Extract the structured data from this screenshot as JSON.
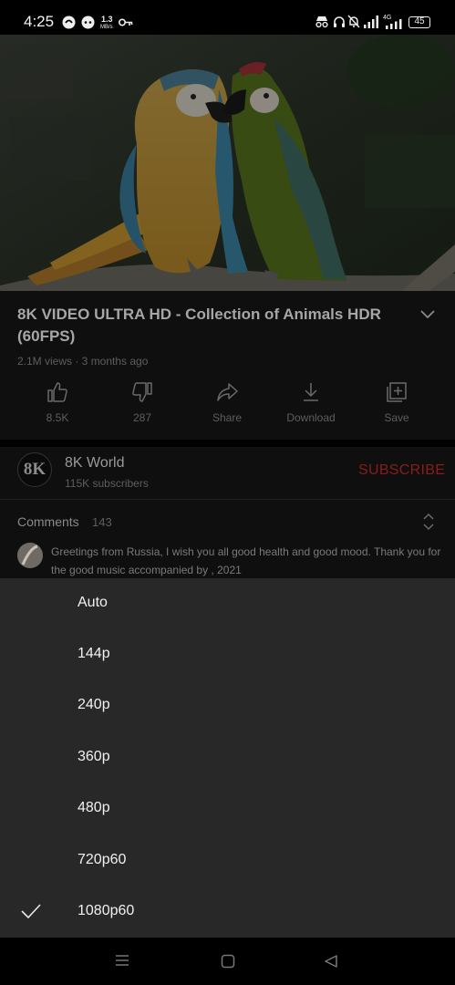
{
  "status_bar": {
    "time": "4:25",
    "speed_value": "1.3",
    "speed_unit": "MB/s",
    "network": "4G",
    "battery": "45"
  },
  "video": {
    "subject": "two macaws perched on a branch"
  },
  "info": {
    "title": "8K VIDEO ULTRA HD - Collection of Animals HDR (60FPS)",
    "meta": "2.1M views · 3 months ago"
  },
  "actions": [
    {
      "label": "8.5K",
      "icon": "thumbs-up-icon"
    },
    {
      "label": "287",
      "icon": "thumbs-down-icon"
    },
    {
      "label": "Share",
      "icon": "share-icon"
    },
    {
      "label": "Download",
      "icon": "download-icon"
    },
    {
      "label": "Save",
      "icon": "save-to-playlist-icon"
    }
  ],
  "channel": {
    "avatar_text": "8K",
    "name": "8K World",
    "subscribers": "115K subscribers",
    "subscribe_label": "SUBSCRIBE",
    "subscribe_color": "#8a1c1c"
  },
  "comments": {
    "title": "Comments",
    "count": "143",
    "top_comment": "Greetings from Russia, I wish you all good health and good mood. Thank you for the good music accompanied by , 2021"
  },
  "quality_sheet": {
    "options": [
      "Auto",
      "144p",
      "240p",
      "360p",
      "480p",
      "720p60",
      "1080p60"
    ],
    "selected": "1080p60"
  },
  "nav_bar": {
    "buttons": [
      "menu-icon",
      "home-icon",
      "back-icon"
    ]
  }
}
